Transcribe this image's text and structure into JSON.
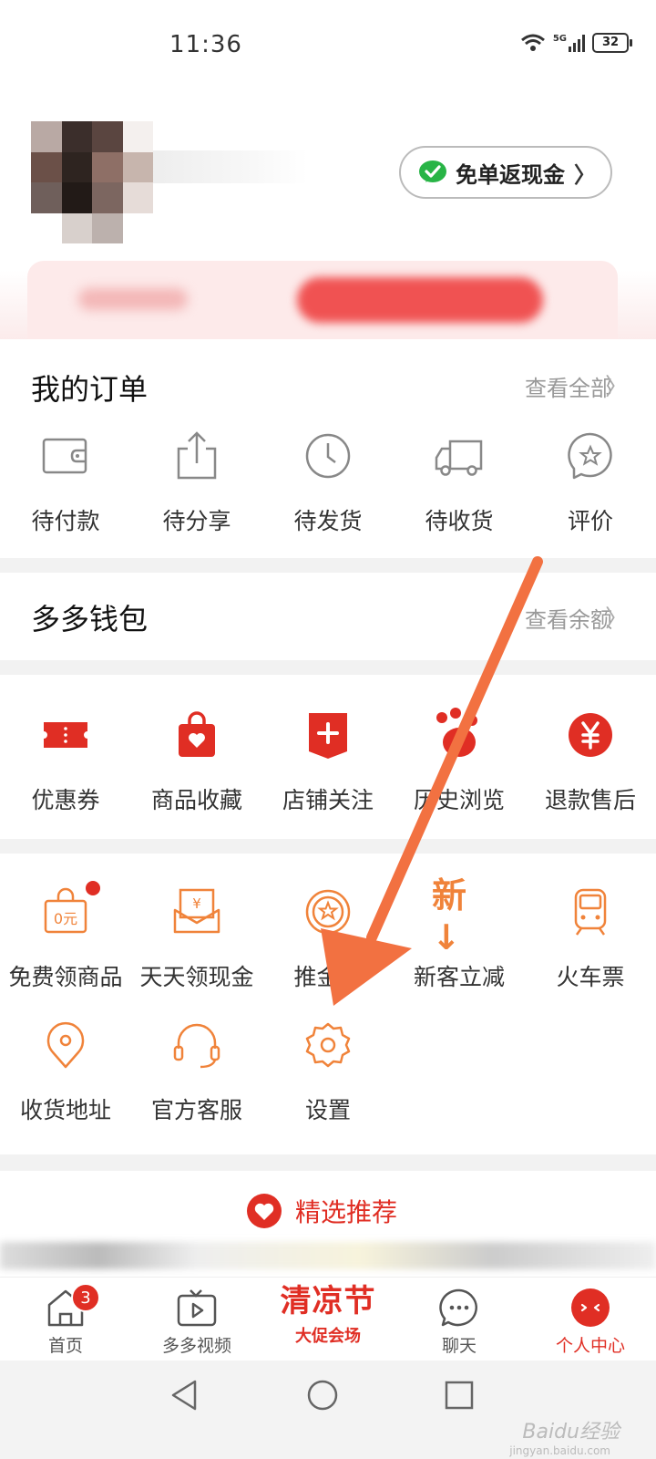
{
  "status_bar": {
    "time": "11:36",
    "network": "5G",
    "battery": "32"
  },
  "header": {
    "cashback_label": "免单返现金",
    "avatar_colors": [
      "#b9a9a4",
      "#3b2e2b",
      "#5a4540",
      "#f4f0ee",
      "#6b5048",
      "#2e2420",
      "#8e6f66",
      "#c7b5ad",
      "#6f5f5b",
      "#221a17",
      "#7c6660",
      "#e6dcd8",
      "#ffffff",
      "#d8d0cc",
      "#bcb1ad",
      "#ffffff"
    ]
  },
  "orders": {
    "title": "我的订单",
    "link": "查看全部",
    "items": [
      {
        "label": "待付款",
        "icon": "wallet-icon"
      },
      {
        "label": "待分享",
        "icon": "share-icon"
      },
      {
        "label": "待发货",
        "icon": "clock-icon"
      },
      {
        "label": "待收货",
        "icon": "truck-icon"
      },
      {
        "label": "评价",
        "icon": "review-star-icon"
      }
    ]
  },
  "wallet": {
    "title": "多多钱包",
    "link": "查看余额"
  },
  "services": {
    "items": [
      {
        "label": "优惠券",
        "icon": "coupon-icon"
      },
      {
        "label": "商品收藏",
        "icon": "favorites-bag-icon"
      },
      {
        "label": "店铺关注",
        "icon": "store-follow-icon"
      },
      {
        "label": "历史浏览",
        "icon": "footprint-icon"
      },
      {
        "label": "退款售后",
        "icon": "refund-yen-icon"
      }
    ]
  },
  "tools": {
    "row1": [
      {
        "label": "免费领商品",
        "icon": "free-goods-bag-icon"
      },
      {
        "label": "天天领现金",
        "icon": "daily-cash-icon"
      },
      {
        "label": "推金币",
        "icon": "coin-icon"
      },
      {
        "label": "新客立减",
        "icon": "new-customer-icon",
        "glyph": "新↓"
      },
      {
        "label": "火车票",
        "icon": "train-icon"
      }
    ],
    "row2": [
      {
        "label": "收货地址",
        "icon": "location-pin-icon"
      },
      {
        "label": "官方客服",
        "icon": "headset-icon"
      },
      {
        "label": "设置",
        "icon": "settings-gear-icon"
      }
    ]
  },
  "recommend": {
    "title": "精选推荐"
  },
  "tabbar": {
    "items": [
      {
        "label": "首页",
        "badge": "3",
        "icon": "home-icon"
      },
      {
        "label": "多多视频",
        "icon": "video-icon"
      },
      {
        "label": "大促会场",
        "promo": "清凉节",
        "icon": "promo-icon"
      },
      {
        "label": "聊天",
        "icon": "chat-icon"
      },
      {
        "label": "个人中心",
        "icon": "profile-face-icon"
      }
    ]
  },
  "watermark": {
    "text": "Baidu经验",
    "sub": "jingyan.baidu.com"
  },
  "colors": {
    "brand_red": "#e02e24",
    "accent_orange": "#f0833a",
    "arrow": "#f27141"
  }
}
